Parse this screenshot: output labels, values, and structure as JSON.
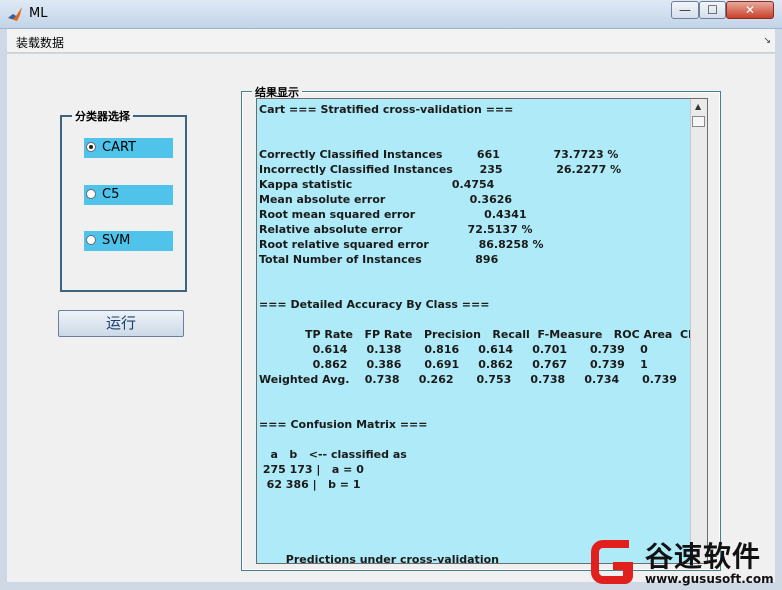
{
  "window": {
    "title": "ML",
    "minimize_label": "—",
    "maximize_label": "☐",
    "close_label": "✕"
  },
  "menu": {
    "load_data_label": "装载数据",
    "menu_arrow": "↘"
  },
  "classifier_group": {
    "title": "分类器选择",
    "options": [
      {
        "label": "CART",
        "selected": true
      },
      {
        "label": "C5",
        "selected": false
      },
      {
        "label": "SVM",
        "selected": false
      }
    ]
  },
  "run_button_label": "运行",
  "results_group": {
    "title": "结果显示",
    "lines": [
      "Cart === Stratified cross-validation ===",
      "",
      "",
      "Correctly Classified Instances         661              73.7723 %",
      "Incorrectly Classified Instances       235              26.2277 %",
      "Kappa statistic                          0.4754",
      "Mean absolute error                      0.3626",
      "Root mean squared error                  0.4341",
      "Relative absolute error                 72.5137 %",
      "Root relative squared error             86.8258 %",
      "Total Number of Instances              896",
      "",
      "",
      "=== Detailed Accuracy By Class ===",
      "",
      "            TP Rate   FP Rate   Precision   Recall  F-Measure   ROC Area  Class",
      "              0.614     0.138      0.816     0.614     0.701      0.739    0",
      "              0.862     0.386      0.691     0.862     0.767      0.739    1",
      "Weighted Avg.    0.738     0.262      0.753     0.738     0.734      0.739",
      "",
      "",
      "=== Confusion Matrix ===",
      "",
      "   a   b   <-- classified as",
      " 275 173 |   a = 0",
      "  62 386 |   b = 1",
      "",
      "",
      "",
      "",
      "       Predictions under cross-validation"
    ]
  },
  "watermark": {
    "name": "谷速软件",
    "url": "www.gususoft.com"
  },
  "colors": {
    "result_bg": "#aeeaf7",
    "radio_bg": "#4fc3ea",
    "group_border": "#3d6480",
    "watermark_red": "#e1201d"
  }
}
